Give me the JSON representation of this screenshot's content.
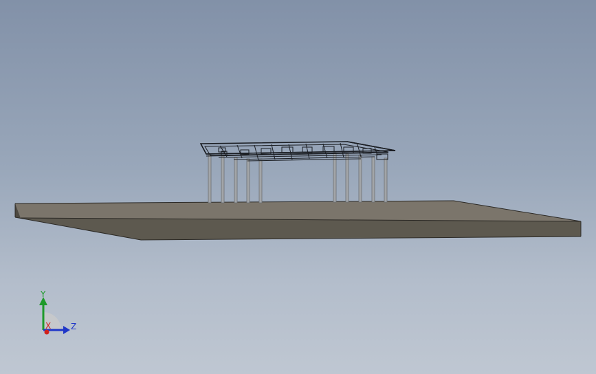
{
  "viewport": {
    "description_free": true
  },
  "triad": {
    "y_label": "Y",
    "z_label": "Z",
    "x_label": "X",
    "y_color": "#1e9a2a",
    "z_color": "#1f36c8",
    "x_color": "#d0201c"
  },
  "colors": {
    "slab_top": "#7b756b",
    "slab_front": "#5d594f",
    "slab_side": "#57534a",
    "column": "#9ea1a4",
    "frame": "#1a1d22"
  }
}
